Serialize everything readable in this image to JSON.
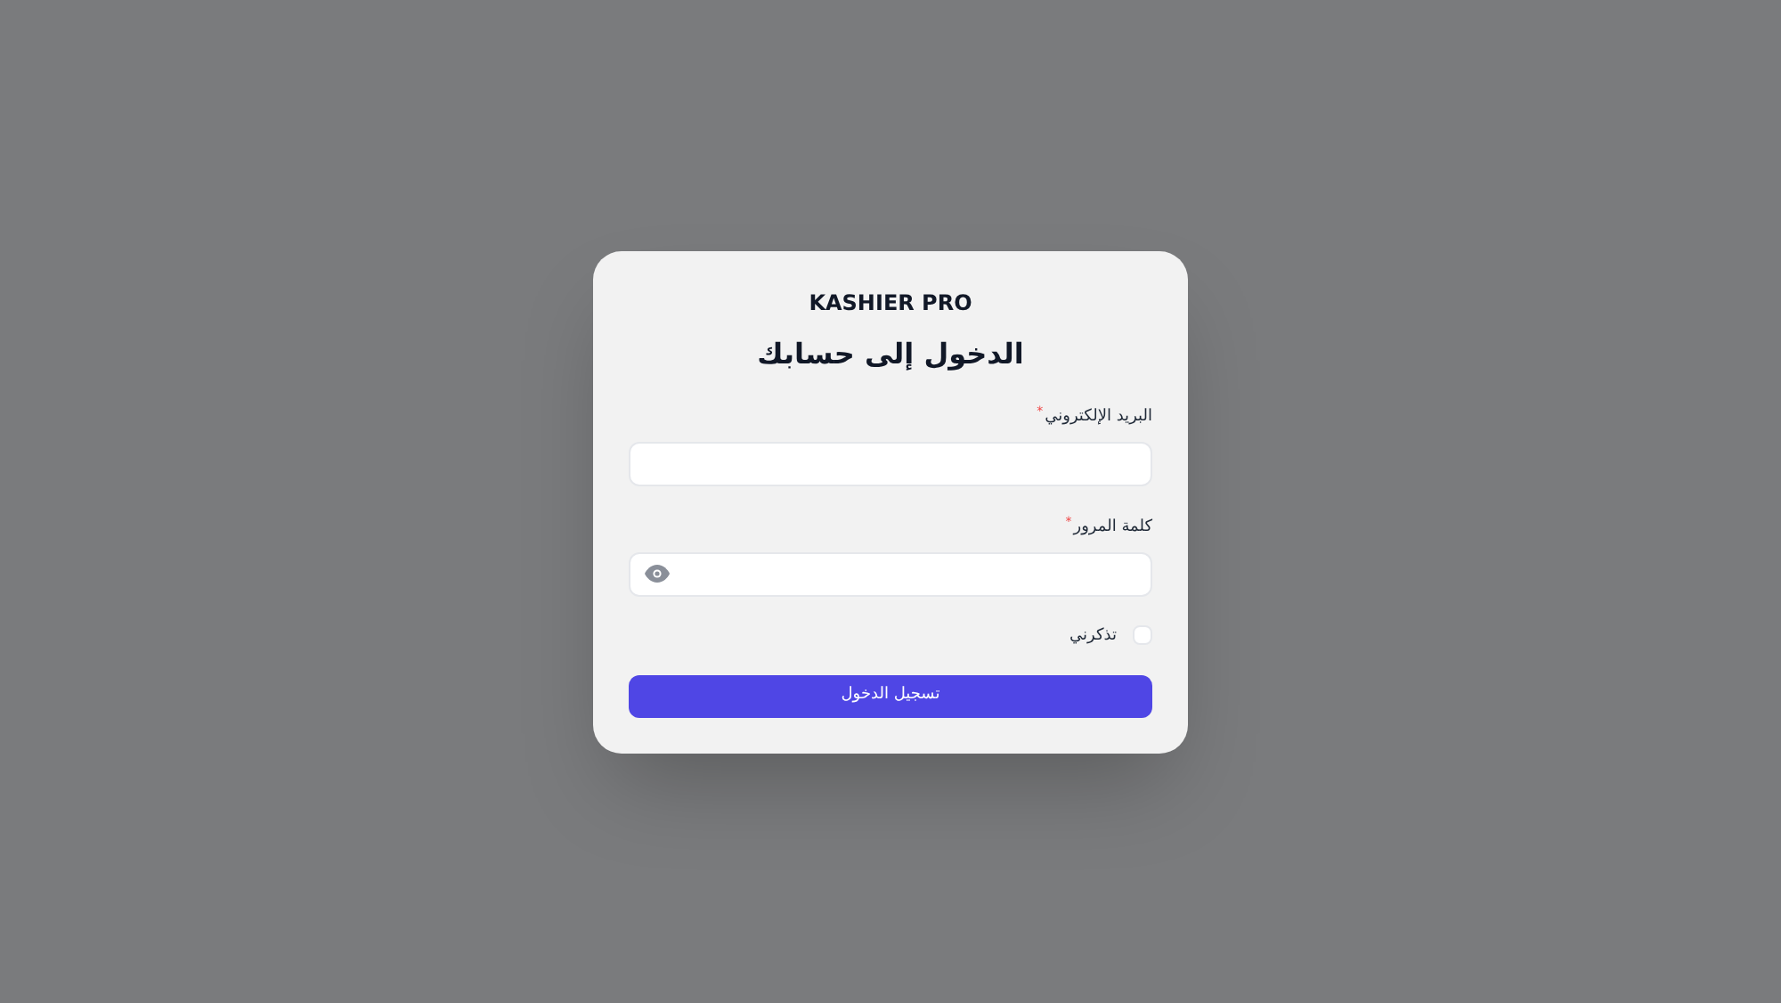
{
  "brand": "KASHIER PRO",
  "heading": "الدخول إلى حسابك",
  "fields": [
    {
      "kind": "email",
      "label": "البريد الإلكتروني",
      "required_mark": "*"
    },
    {
      "kind": "password",
      "label": "كلمة المرور",
      "required_mark": "*"
    }
  ],
  "remember": {
    "label": "تذكرني",
    "checked": false
  },
  "submit": "تسجيل الدخول"
}
